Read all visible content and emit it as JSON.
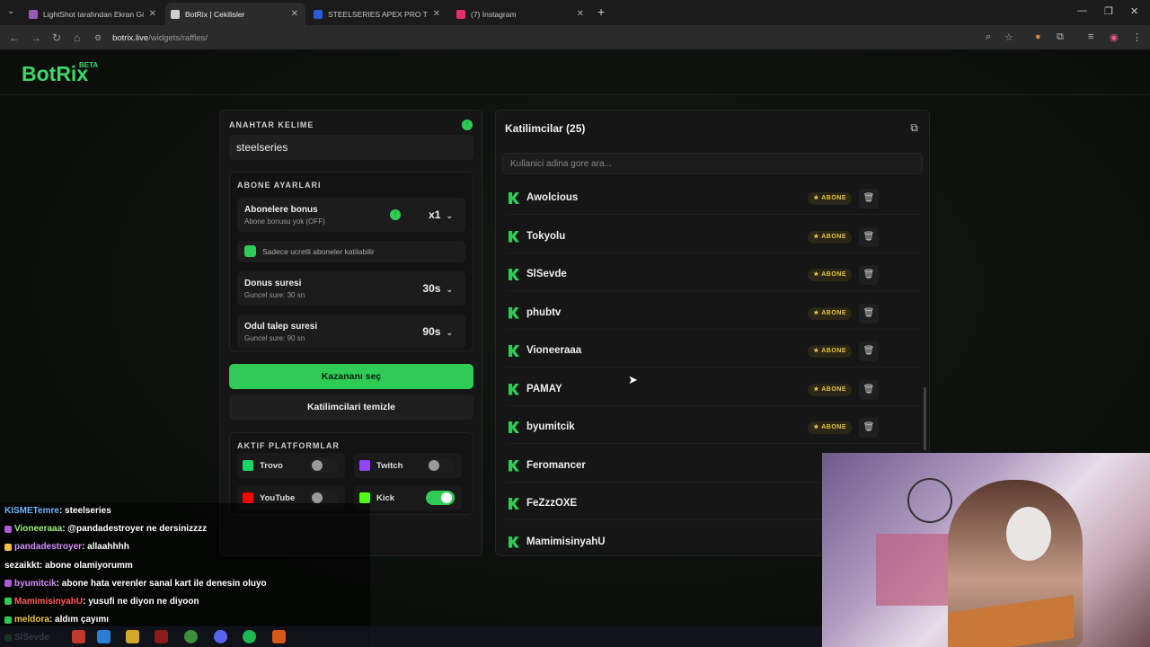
{
  "browser": {
    "tabs": [
      {
        "title": "LightShot tarafından Ekran Görü",
        "active": false,
        "icon_color": "#9b59b6"
      },
      {
        "title": "BotRix | Cekilisler",
        "active": true,
        "icon_color": "#cfcfcf"
      },
      {
        "title": "STEELSERIES APEX PRO TKL GEN",
        "active": false,
        "icon_color": "#2b5cd6"
      },
      {
        "title": "(7) Instagram",
        "active": false,
        "icon_color": "#e1306c"
      }
    ],
    "url_host": "botrix.live",
    "url_path": "/widgets/raffles/"
  },
  "brand": {
    "logo": "BotRix",
    "badge": "BETA",
    "accent": "#3fd86a"
  },
  "settings": {
    "keyword_title": "ANAHTAR KELIME",
    "keyword_value": "steelseries",
    "sub_title": "ABONE AYARLARI",
    "bonus_label": "Abonelere bonus",
    "bonus_sub": "Abone bonusu yok (OFF)",
    "bonus_value": "x1",
    "paid_only_label": "Sadece ucretli aboneler katilabilir",
    "duration_label": "Donus suresi",
    "duration_sub": "Guncel sure: 30 sn",
    "duration_value": "30s",
    "claim_label": "Odul talep suresi",
    "claim_sub": "Guncel sure: 90 sn",
    "claim_value": "90s",
    "pick_winner": "Kazananı seç",
    "clear_participants": "Katilimcilari temizle",
    "platforms_title": "AKTIF PLATFORMLAR",
    "platforms": [
      {
        "name": "Trovo",
        "enabled": false,
        "color": "#19d66b"
      },
      {
        "name": "Twitch",
        "enabled": false,
        "color": "#9146ff"
      },
      {
        "name": "YouTube",
        "enabled": false,
        "color": "#ff0000"
      },
      {
        "name": "Kick",
        "enabled": true,
        "color": "#53fc18"
      }
    ]
  },
  "participants": {
    "title": "Katilimcilar (25)",
    "search_placeholder": "Kullanici adina gore ara...",
    "badge_label": "ABONE",
    "users": [
      {
        "name": "Awolcious",
        "subscriber": true
      },
      {
        "name": "Tokyolu",
        "subscriber": true
      },
      {
        "name": "SlSevde",
        "subscriber": true
      },
      {
        "name": "phubtv",
        "subscriber": true
      },
      {
        "name": "Vioneeraaa",
        "subscriber": true
      },
      {
        "name": "PAMAY",
        "subscriber": true
      },
      {
        "name": "byumitcik",
        "subscriber": true
      },
      {
        "name": "Feromancer",
        "subscriber": false
      },
      {
        "name": "FeZzzOXE",
        "subscriber": false
      },
      {
        "name": "MamimisinyahU",
        "subscriber": false
      }
    ]
  },
  "chat": [
    {
      "user": "KISMETemre",
      "msg": ": steelseries",
      "color": "#6fb3ff",
      "badge": ""
    },
    {
      "user": "Vioneeraaa",
      "msg": ": @pandadestroyer ne dersinizzzz",
      "color": "#9ef07a",
      "badge": "#b05ad8"
    },
    {
      "user": "pandadestroyer",
      "msg": ": allaahhhh",
      "color": "#d68cff",
      "badge": "#f0c040"
    },
    {
      "user": "sezaikkt",
      "msg": ": abone olamiyorumm",
      "color": "#ffffff",
      "badge": ""
    },
    {
      "user": "byumitcik",
      "msg": ": abone hata verenler sanal kart ile denesin oluyo",
      "color": "#d68cff",
      "badge": "#b05ad8"
    },
    {
      "user": "MamimisinyahU",
      "msg": ": yusufi ne diyon ne diyoon",
      "color": "#ff5a5a",
      "badge": "#2ecc55"
    },
    {
      "user": "meldora",
      "msg": ": aldım çayımı",
      "color": "#f0c040",
      "badge": "#2ecc55"
    },
    {
      "user": "SlSevde",
      "msg": "",
      "color": "#ffffff",
      "badge": "#2ecc55"
    }
  ]
}
